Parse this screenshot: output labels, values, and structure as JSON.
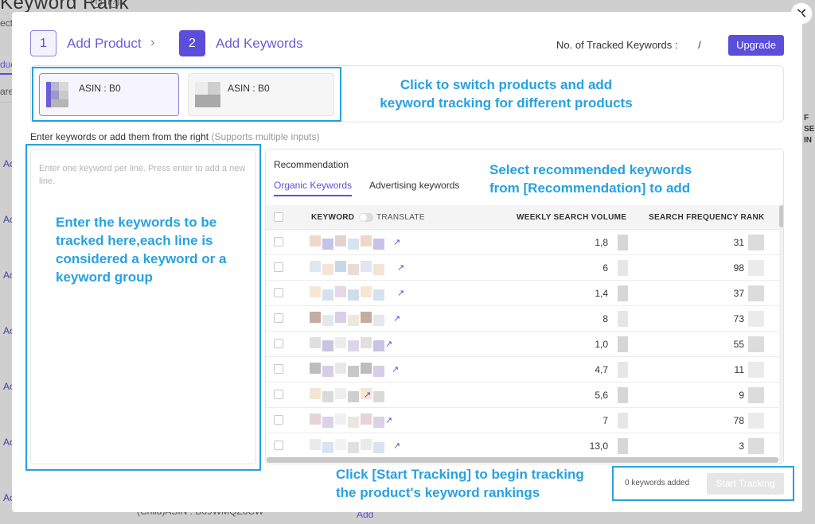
{
  "background": {
    "title": "Keyword Rank",
    "left_labels": [
      "ecte",
      "duc",
      "are"
    ],
    "row_labels": [
      "Ac O",
      "Ac O",
      "Ac O",
      "Ac O",
      "Ac O",
      "Ac O",
      "Ac O"
    ],
    "right_header": "F SE IN",
    "bottom_text": "(Child)ASIN : B09WMQZ6CW",
    "bottom_add": "Add"
  },
  "modal": {
    "close_label": "✕",
    "steps": [
      {
        "number": "1",
        "label": "Add Product"
      },
      {
        "number": "2",
        "label": "Add Keywords"
      }
    ],
    "step_separator": "›",
    "tracked_label": "No. of Tracked Keywords :",
    "tracked_value": "/",
    "upgrade_label": "Upgrade",
    "products": [
      {
        "asin": "ASIN : B0",
        "selected": true
      },
      {
        "asin": "ASIN : B0",
        "selected": false
      }
    ],
    "enter_label": "Enter keywords or add them from the right",
    "enter_hint": "(Supports multiple inputs)",
    "textarea_placeholder": "Enter one keyword per line. Press enter to add a new line.",
    "recommendation": {
      "title": "Recommendation",
      "tabs": [
        "Organic Keywords",
        "Advertising keywords"
      ],
      "columns": {
        "keyword": "KEYWORD",
        "translate": "TRANSLATE",
        "volume": "WEEKLY SEARCH VOLUME",
        "rank": "SEARCH FREQUENCY RANK"
      },
      "rows": [
        {
          "volume": "1,8",
          "rank": "31"
        },
        {
          "volume": "6",
          "rank": "98"
        },
        {
          "volume": "1,4",
          "rank": "37"
        },
        {
          "volume": "8",
          "rank": "73"
        },
        {
          "volume": "1,0",
          "rank": "55"
        },
        {
          "volume": "4,7",
          "rank": "11"
        },
        {
          "volume": "5,6",
          "rank": "9"
        },
        {
          "volume": "7",
          "rank": "78"
        },
        {
          "volume": "13,0",
          "rank": "3"
        }
      ]
    },
    "added_text": "0 keywords added",
    "start_label": "Start Tracking"
  },
  "annotations": {
    "switch_products": "Click to switch products and add keyword tracking for different products",
    "select_recommended": "Select recommended keywords from [Recommendation] to add",
    "enter_keywords": "Enter the keywords to be tracked here,each line is considered a keyword or a keyword group",
    "start_tracking": "Click [Start Tracking] to begin tracking the product's keyword rankings"
  },
  "colors": {
    "accent": "#5b4fd9",
    "annotation": "#27a1e0"
  },
  "icons": {
    "close": "close-icon",
    "info": "info-icon",
    "help": "help-icon",
    "external_link": "external-link-icon"
  }
}
